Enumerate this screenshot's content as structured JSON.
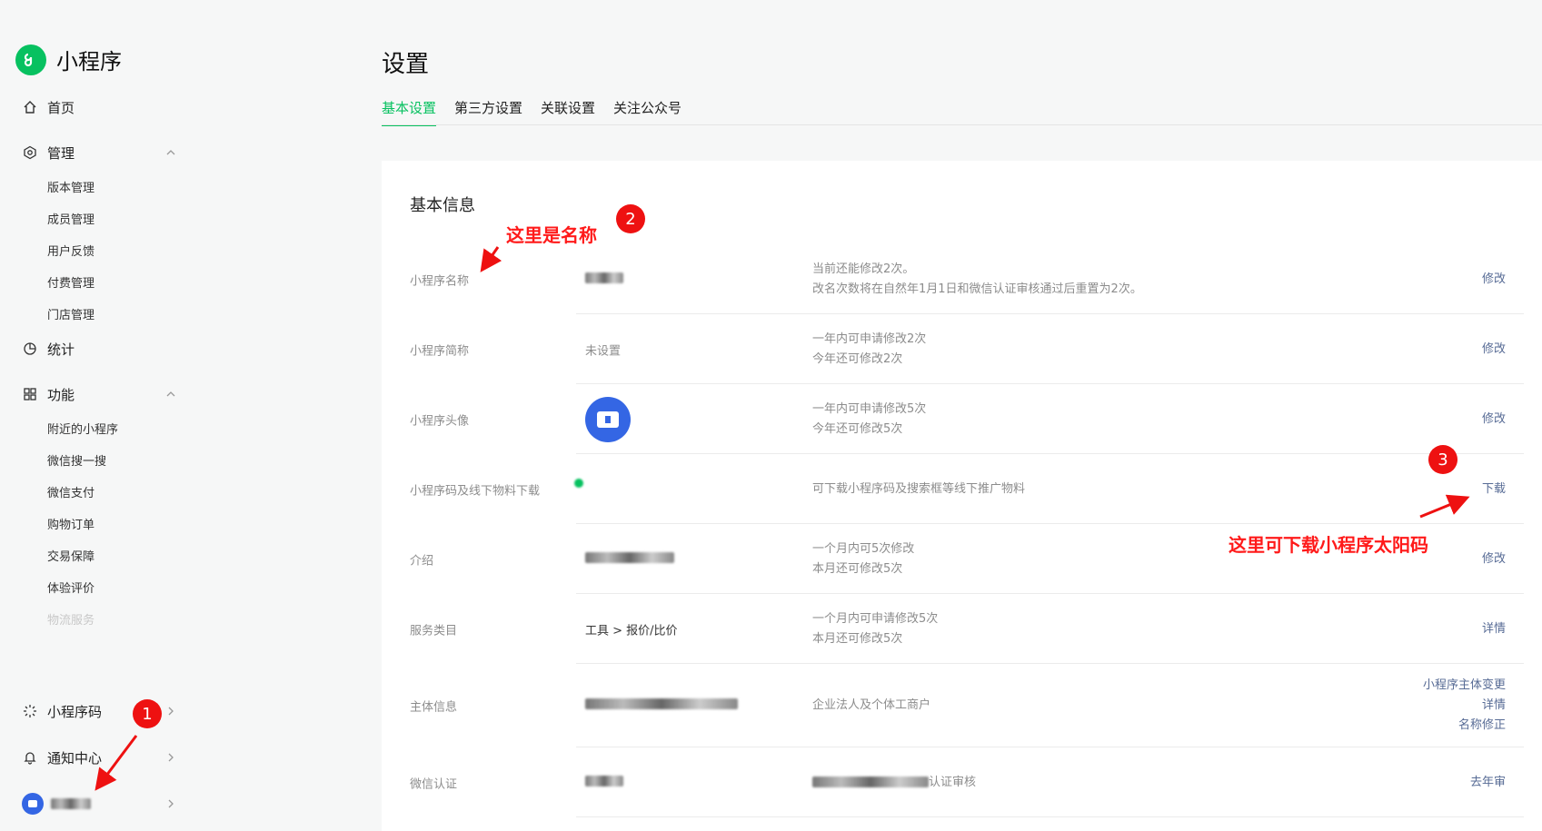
{
  "sidebar": {
    "logo_text": "小程序",
    "nav": [
      {
        "label": "首页"
      },
      {
        "label": "管理"
      },
      {
        "label": "统计"
      },
      {
        "label": "功能"
      },
      {
        "label": "小程序码"
      },
      {
        "label": "通知中心"
      }
    ],
    "manage_items": [
      "版本管理",
      "成员管理",
      "用户反馈",
      "付费管理",
      "门店管理"
    ],
    "function_items": [
      "附近的小程序",
      "微信搜一搜",
      "微信支付",
      "购物订单",
      "交易保障",
      "体验评价",
      "物流服务"
    ]
  },
  "header": {
    "title": "设置",
    "tabs": [
      "基本设置",
      "第三方设置",
      "关联设置",
      "关注公众号"
    ]
  },
  "card": {
    "title": "基本信息",
    "rows": [
      {
        "label": "小程序名称",
        "desc1": "当前还能修改2次。",
        "desc2": "改名次数将在自然年1月1日和微信认证审核通过后重置为2次。",
        "action": "修改"
      },
      {
        "label": "小程序简称",
        "value": "未设置",
        "desc1": "一年内可申请修改2次",
        "desc2": "今年还可修改2次",
        "action": "修改"
      },
      {
        "label": "小程序头像",
        "desc1": "一年内可申请修改5次",
        "desc2": "今年还可修改5次",
        "action": "修改"
      },
      {
        "label": "小程序码及线下物料下载",
        "desc1": "可下载小程序码及搜索框等线下推广物料",
        "action": "下载"
      },
      {
        "label": "介绍",
        "desc1": "一个月内可5次修改",
        "desc2": "本月还可修改5次",
        "action": "修改"
      },
      {
        "label": "服务类目",
        "value": "工具 > 报价/比价",
        "desc1": "一个月内可申请修改5次",
        "desc2": "本月还可修改5次",
        "action": "详情"
      },
      {
        "label": "主体信息",
        "desc1": "企业法人及个体工商户",
        "actions": [
          "小程序主体变更",
          "详情",
          "名称修正"
        ]
      },
      {
        "label": "微信认证",
        "desc1": "认证审核",
        "action": "去年审"
      }
    ]
  },
  "annotations": {
    "name_note": "这里是名称",
    "download_note": "这里可下载小程序太阳码",
    "badges": [
      "1",
      "2",
      "3"
    ]
  },
  "colors": {
    "accent": "#07c160",
    "link": "#576b95",
    "annotation": "#ff1a1a",
    "app_avatar": "#3466e4"
  }
}
